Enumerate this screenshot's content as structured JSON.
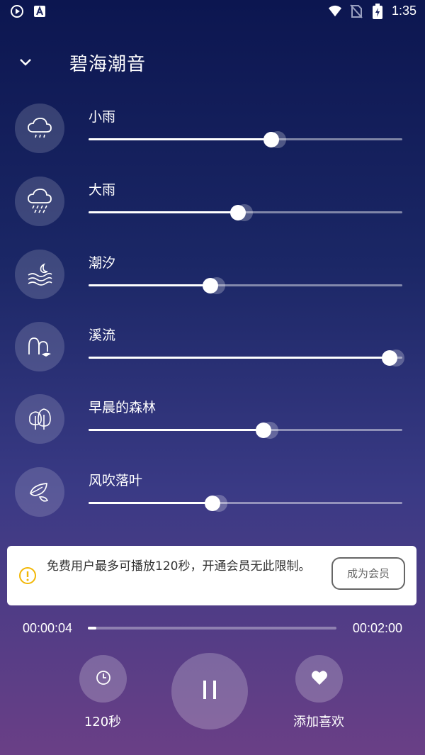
{
  "status_bar": {
    "time": "1:35",
    "left_icons": [
      "play-circle-icon",
      "a-badge-icon"
    ],
    "right_icons": [
      "wifi-icon",
      "no-sim-icon",
      "battery-charging-icon"
    ]
  },
  "header": {
    "title": "碧海潮音",
    "back_icon": "chevron-down-icon"
  },
  "sounds": [
    {
      "label": "小雨",
      "icon": "cloud-drizzle-icon",
      "volume": 0.583
    },
    {
      "label": "大雨",
      "icon": "cloud-rain-icon",
      "volume": 0.476
    },
    {
      "label": "潮汐",
      "icon": "waves-moon-icon",
      "volume": 0.388
    },
    {
      "label": "溪流",
      "icon": "stream-arches-icon",
      "volume": 0.959
    },
    {
      "label": "早晨的森林",
      "icon": "trees-icon",
      "volume": 0.558
    },
    {
      "label": "风吹落叶",
      "icon": "leaf-icon",
      "volume": 0.395
    }
  ],
  "notice": {
    "icon": "warning-circle-icon",
    "text": "免费用户最多可播放120秒，开通会员无此限制。",
    "button_label": "成为会员"
  },
  "player": {
    "current_time": "00:00:04",
    "total_time": "00:02:00",
    "progress": 0.033,
    "timer_label": "120秒",
    "timer_icon": "clock-icon",
    "play_pause_icon": "pause-icon",
    "favorite_label": "添加喜欢",
    "favorite_icon": "heart-icon"
  },
  "colors": {
    "accent": "#ffffff",
    "notice_bg": "#ffffff",
    "warning": "#f2b705"
  }
}
